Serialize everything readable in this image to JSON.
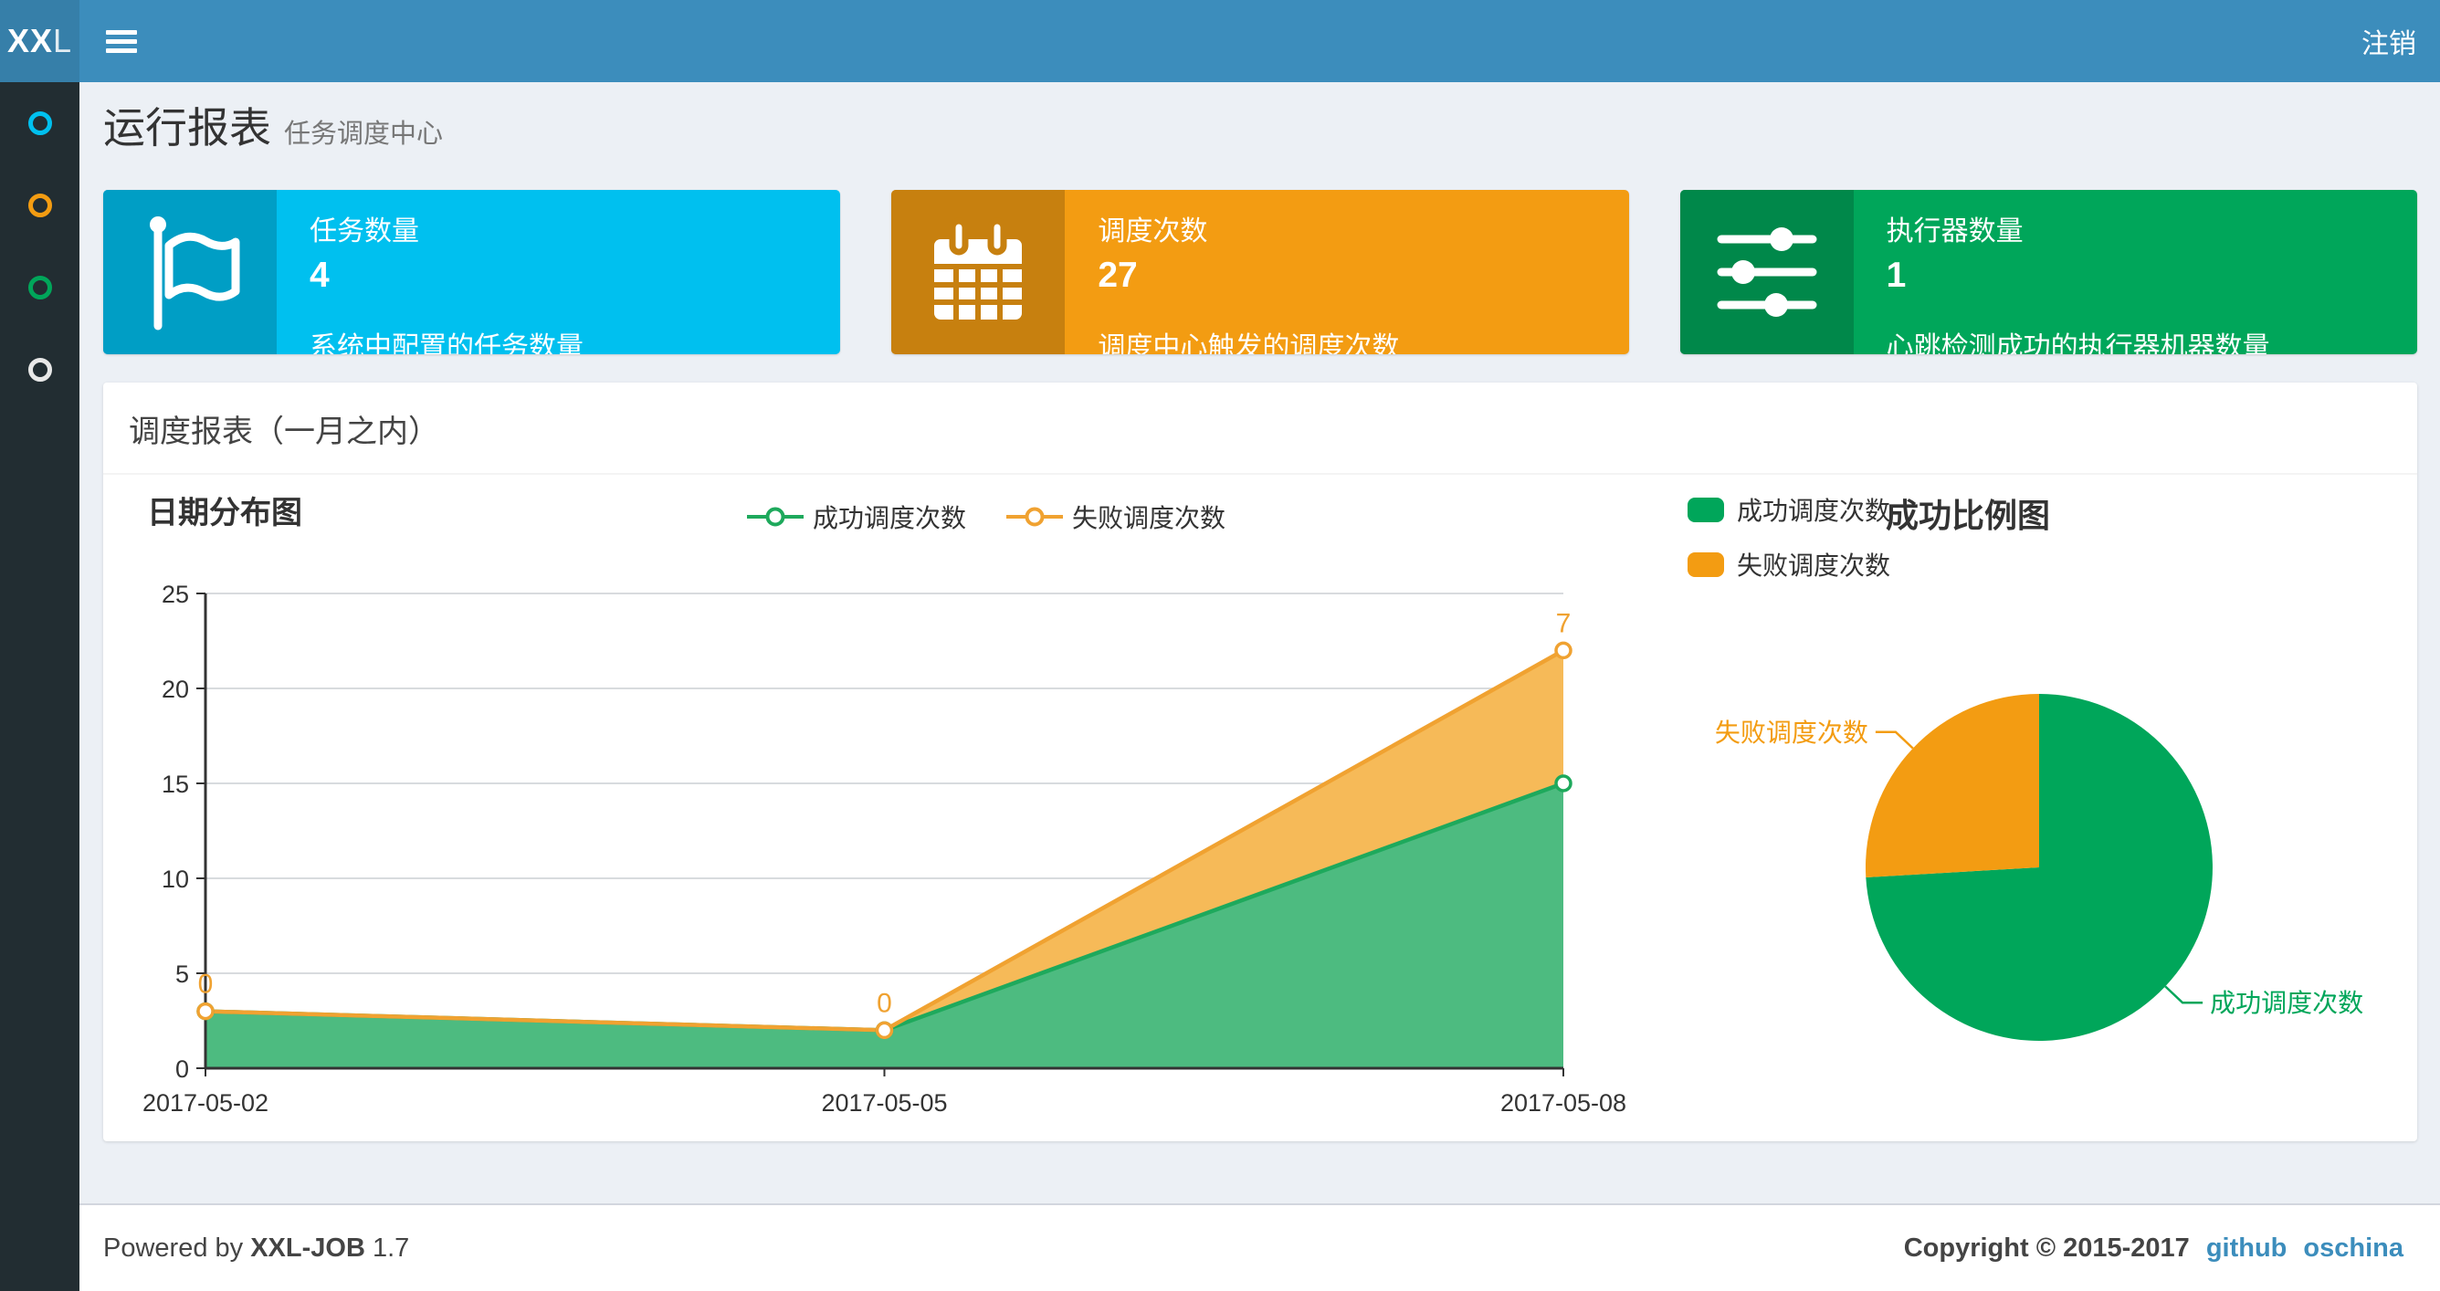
{
  "navbar": {
    "logo_bold": "XX",
    "logo_light": "L",
    "logout_label": "注销"
  },
  "sidebar": {
    "items": [
      {
        "name": "menu-item-1",
        "color": "#00c0ef"
      },
      {
        "name": "menu-item-2",
        "color": "#f39c12"
      },
      {
        "name": "menu-item-3",
        "color": "#00a65a"
      },
      {
        "name": "menu-item-4",
        "color": "#e8e8e8"
      }
    ]
  },
  "page_header": {
    "title": "运行报表",
    "subtitle": "任务调度中心"
  },
  "info_boxes": [
    {
      "label": "任务数量",
      "value": "4",
      "desc": "系统中配置的任务数量",
      "color": "#00c0ef",
      "icon_bg": "#009ec5",
      "icon": "flag-icon"
    },
    {
      "label": "调度次数",
      "value": "27",
      "desc": "调度中心触发的调度次数",
      "color": "#f39c12",
      "icon_bg": "#c7800f",
      "icon": "calendar-icon"
    },
    {
      "label": "执行器数量",
      "value": "1",
      "desc": "心跳检测成功的执行器机器数量",
      "color": "#00a65a",
      "icon_bg": "#00884a",
      "icon": "sliders-icon"
    }
  ],
  "panel": {
    "title": "调度报表（一月之内）"
  },
  "chart_data": [
    {
      "type": "area",
      "title": "日期分布图",
      "x": [
        "2017-05-02",
        "2017-05-05",
        "2017-05-08"
      ],
      "series": [
        {
          "name": "成功调度次数",
          "values": [
            3,
            2,
            15
          ],
          "color": "#1ea95c",
          "area_color": "#4dbb80"
        },
        {
          "name": "失败调度次数",
          "values": [
            0,
            0,
            7
          ],
          "color": "#f0a231",
          "area_color": "#f6ba58"
        }
      ],
      "stacked": true,
      "point_labels": [
        "0",
        "0",
        "7"
      ],
      "ylim": [
        0,
        25
      ],
      "yticks": [
        0,
        5,
        10,
        15,
        20,
        25
      ],
      "grid": true,
      "legend_position": "top-center"
    },
    {
      "type": "pie",
      "title": "成功比例图",
      "slices": [
        {
          "name": "成功调度次数",
          "value": 20,
          "color": "#00a65a"
        },
        {
          "name": "失败调度次数",
          "value": 7,
          "color": "#f39c12"
        }
      ],
      "legend_position": "top-left"
    }
  ],
  "footer": {
    "powered_prefix": "Powered by",
    "product": "XXL-JOB",
    "version": "1.7",
    "copyright": "Copyright © 2015-2017",
    "links": [
      {
        "label": "github"
      },
      {
        "label": "oschina"
      }
    ]
  }
}
